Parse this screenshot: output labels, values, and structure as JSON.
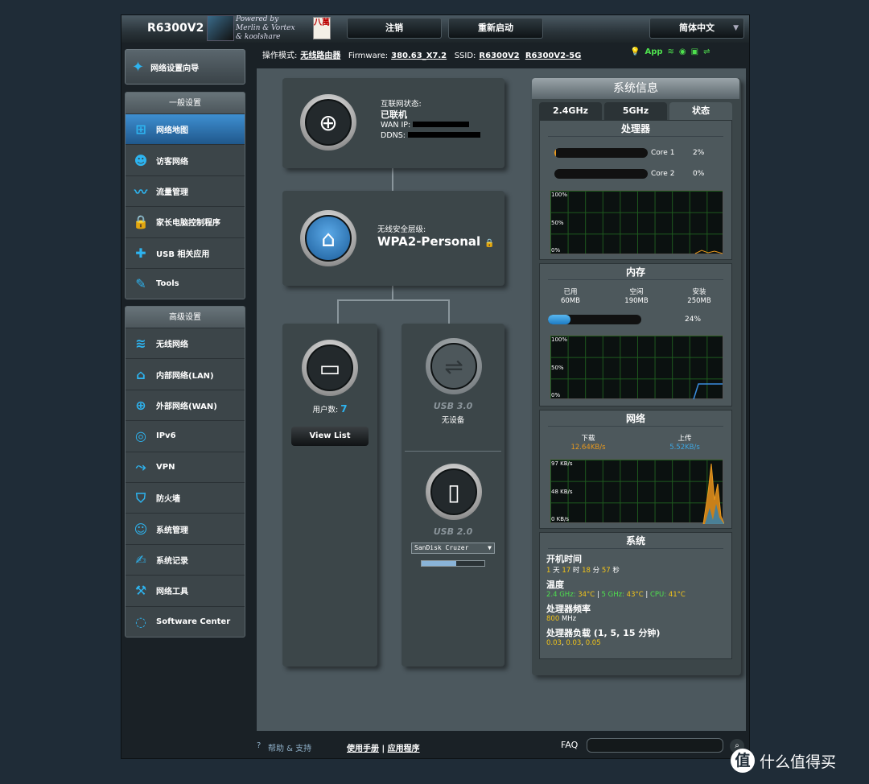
{
  "header": {
    "model": "R6300V2",
    "powered": "Powered by",
    "credits_1": "Merlin & Vortex",
    "credits_2": "& koolshare",
    "badge": "八萬",
    "logout": "注销",
    "reboot": "重新启动",
    "language": "简体中文"
  },
  "status": {
    "mode_label": "操作模式:",
    "mode_value": "无线路由器",
    "fw_label": "Firmware:",
    "fw_value": "380.63_X7.2",
    "ssid_label": "SSID:",
    "ssid_1": "R6300V2",
    "ssid_2": "R6300V2-5G",
    "app_label": "App"
  },
  "sidebar": {
    "wizard": "网络设置向导",
    "general_head": "一般设置",
    "general": [
      {
        "label": "网络地图",
        "icon": "network-map-icon",
        "active": true
      },
      {
        "label": "访客网络",
        "icon": "guest-network-icon"
      },
      {
        "label": "流量管理",
        "icon": "traffic-icon"
      },
      {
        "label": "家长电脑控制程序",
        "icon": "parental-lock-icon"
      },
      {
        "label": "USB 相关应用",
        "icon": "puzzle-icon"
      },
      {
        "label": "Tools",
        "icon": "wrench-icon"
      }
    ],
    "advanced_head": "高级设置",
    "advanced": [
      {
        "label": "无线网络",
        "icon": "wifi-icon"
      },
      {
        "label": "内部网络(LAN)",
        "icon": "home-icon"
      },
      {
        "label": "外部网络(WAN)",
        "icon": "globe-icon"
      },
      {
        "label": "IPv6",
        "icon": "ipv6-icon"
      },
      {
        "label": "VPN",
        "icon": "vpn-icon"
      },
      {
        "label": "防火墙",
        "icon": "shield-icon"
      },
      {
        "label": "系统管理",
        "icon": "user-icon"
      },
      {
        "label": "系统记录",
        "icon": "log-icon"
      },
      {
        "label": "网络工具",
        "icon": "tools-icon"
      },
      {
        "label": "Software Center",
        "icon": "swirl-icon"
      }
    ]
  },
  "map": {
    "internet_label": "互联网状态:",
    "internet_value": "已联机",
    "wan_label": "WAN IP:",
    "ddns_label": "DDNS:",
    "wifi_label": "无线安全层级:",
    "wifi_value": "WPA2-Personal",
    "clients_label": "用户数:",
    "clients_value": "7",
    "view_list": "View List",
    "usb3": "USB 3.0",
    "usb3_status": "无设备",
    "usb2": "USB 2.0",
    "usb2_device": "SanDisk Cruzer",
    "usb2_progress": 0.55
  },
  "panel": {
    "title": "系统信息",
    "tabs": [
      "2.4GHz",
      "5GHz",
      "状态"
    ],
    "cpu": {
      "head": "处理器",
      "cores": [
        {
          "name": "Core 1",
          "pct": "2%",
          "value": 0.02
        },
        {
          "name": "Core 2",
          "pct": "0%",
          "value": 0
        }
      ],
      "ticks": [
        "100%",
        "50%",
        "0%"
      ]
    },
    "mem": {
      "head": "内存",
      "used_label": "已用",
      "used": "60MB",
      "free_label": "空闲",
      "free": "190MB",
      "total_label": "安装",
      "total": "250MB",
      "pct": "24%",
      "value": 0.24,
      "ticks": [
        "100%",
        "50%",
        "0%"
      ]
    },
    "net": {
      "head": "网络",
      "down_label": "下载",
      "down": "12.64KB/s",
      "up_label": "上传",
      "up": "5.52KB/s",
      "ticks": [
        "97 KB/s",
        "48 KB/s",
        "0 KB/s"
      ]
    },
    "sys": {
      "head": "系统",
      "uptime_label": "开机时间",
      "uptime": {
        "d": "1",
        "d_u": "天",
        "h": "17",
        "h_u": "时",
        "m": "18",
        "m_u": "分",
        "s": "57",
        "s_u": "秒"
      },
      "temp_label": "温度",
      "t24": "2.4 GHz:",
      "t24v": "34°C",
      "t5": "5 GHz:",
      "t5v": "43°C",
      "tcpu": "CPU:",
      "tcpuv": "41°C",
      "freq_label": "处理器频率",
      "freq": "800",
      "freq_u": "MHz",
      "load_label": "处理器负载 (1, 5, 15 分钟)",
      "load": [
        "0.03",
        "0.03",
        "0.05"
      ]
    }
  },
  "footer": {
    "help": "帮助 & 支持",
    "manual": "使用手册",
    "sep": "|",
    "apps": "应用程序",
    "faq": "FAQ",
    "watermark": "什么值得买"
  },
  "colors": {
    "accent": "#2db4f0",
    "active": "#3e8fd1",
    "yellow": "#f2c419",
    "green": "#4ee04e"
  }
}
